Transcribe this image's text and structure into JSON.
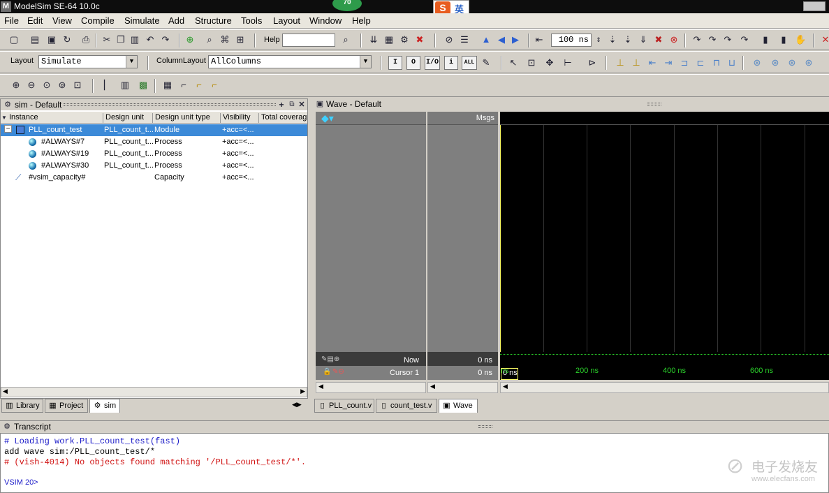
{
  "titlebar": {
    "title": "ModelSim SE-64 10.0c",
    "badge": "70",
    "ime_logo": "S",
    "ime_lang": "英"
  },
  "menu": [
    "File",
    "Edit",
    "View",
    "Compile",
    "Simulate",
    "Add",
    "Structure",
    "Tools",
    "Layout",
    "Window",
    "Help"
  ],
  "toolbar1": {
    "help_label": "Help",
    "help_value": "",
    "run_length": "100 ns"
  },
  "toolbar2": {
    "layout_label": "Layout",
    "layout_value": "Simulate",
    "columnlayout_label": "ColumnLayout",
    "columnlayout_value": "AllColumns",
    "btn_i": "I",
    "btn_o": "O",
    "btn_io": "I/O",
    "btn_info": "i",
    "btn_all": "ALL"
  },
  "sim_panel": {
    "title": "sim - Default",
    "columns": [
      "Instance",
      "Design unit",
      "Design unit type",
      "Visibility",
      "Total coverag"
    ],
    "rows": [
      {
        "instance": "PLL_count_test",
        "unit": "PLL_count_t...",
        "type": "Module",
        "vis": "+acc=<..."
      },
      {
        "instance": "#ALWAYS#7",
        "unit": "PLL_count_t...",
        "type": "Process",
        "vis": "+acc=<..."
      },
      {
        "instance": "#ALWAYS#19",
        "unit": "PLL_count_t...",
        "type": "Process",
        "vis": "+acc=<..."
      },
      {
        "instance": "#ALWAYS#30",
        "unit": "PLL_count_t...",
        "type": "Process",
        "vis": "+acc=<..."
      },
      {
        "instance": "#vsim_capacity#",
        "unit": "",
        "type": "Capacity",
        "vis": "+acc=<..."
      }
    ],
    "tabs": [
      "Library",
      "Project",
      "sim"
    ]
  },
  "wave_panel": {
    "title": "Wave - Default",
    "msgs_label": "Msgs",
    "now_label": "Now",
    "now_value": "0 ns",
    "cursor_label": "Cursor 1",
    "cursor_value": "0 ns",
    "cursor_time": "0 ns",
    "ticks": [
      "ns",
      "200 ns",
      "400 ns",
      "600 ns"
    ],
    "tabs": [
      "PLL_count.v",
      "count_test.v",
      "Wave"
    ]
  },
  "transcript": {
    "title": "Transcript",
    "lines": [
      {
        "text": "# Loading work.PLL_count_test(fast)",
        "color": "#1a1ac8"
      },
      {
        "text": "add wave sim:/PLL_count_test/*",
        "color": "#000000"
      },
      {
        "text": "# (vish-4014) No objects found matching '/PLL_count_test/*'.",
        "color": "#d01010"
      }
    ],
    "prompt": "VSIM 20>"
  },
  "watermark": {
    "cn": "电子发烧友",
    "url": "www.elecfans.com"
  },
  "colors": {
    "selection": "#3c8ad8",
    "wave_bg": "#000000",
    "wave_tick": "#2bd12b",
    "cursor": "#ffff66"
  }
}
